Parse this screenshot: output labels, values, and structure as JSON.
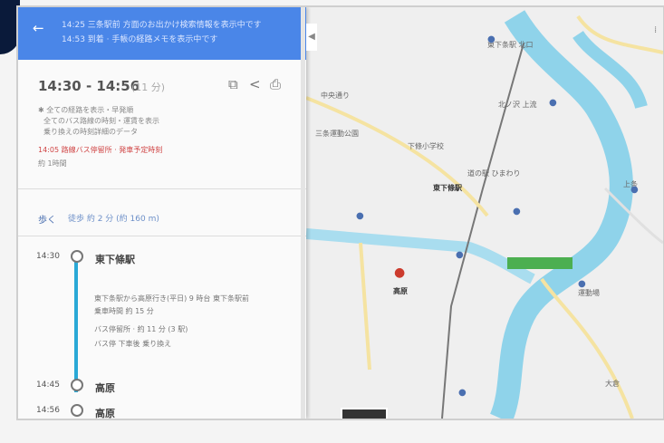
{
  "header": {
    "line1": "14:25 三条駅前 方面のお出かけ検索情報を表示中です",
    "line2": "14:53 到着 · 手帳の経路メモを表示中です"
  },
  "summary": {
    "time": "14:30 - 14:56",
    "duration": "(11 分)",
    "icons": [
      "copy-icon",
      "share-icon",
      "print-icon"
    ]
  },
  "route_notes": [
    "✱ 全ての経路を表示・早発順",
    "全てのバス路線の時刻・運賃を表示",
    "乗り換えの時刻詳細のデータ",
    "14:05 路線バス停留所 · 発車予定時刻",
    "約 1時間"
  ],
  "walk": {
    "label": "歩く",
    "text": "徒歩 約 2 分 (約 160 m)"
  },
  "timeline": [
    {
      "time": "14:30",
      "stop": "東下條駅"
    },
    {
      "time": "14:45",
      "stop": "高原"
    },
    {
      "time": "14:56",
      "stop": "高原"
    }
  ],
  "timeline_details": [
    "東下条駅から高原行き(平日) 9 時台  東下条駅前",
    "乗車時間 約 15 分",
    "バス停留所 · 約 11 分 (3 駅)",
    "バス停 下車後 乗り換え"
  ],
  "map": {
    "labels": [
      "東下条駅 北口",
      "北ノ沢 上流",
      "中央通り",
      "三条運動公園",
      "下條小学校",
      "東下條駅",
      "高原",
      "道の駅 ひまわり",
      "上条",
      "運動場",
      "大倉"
    ],
    "green_label": ""
  }
}
